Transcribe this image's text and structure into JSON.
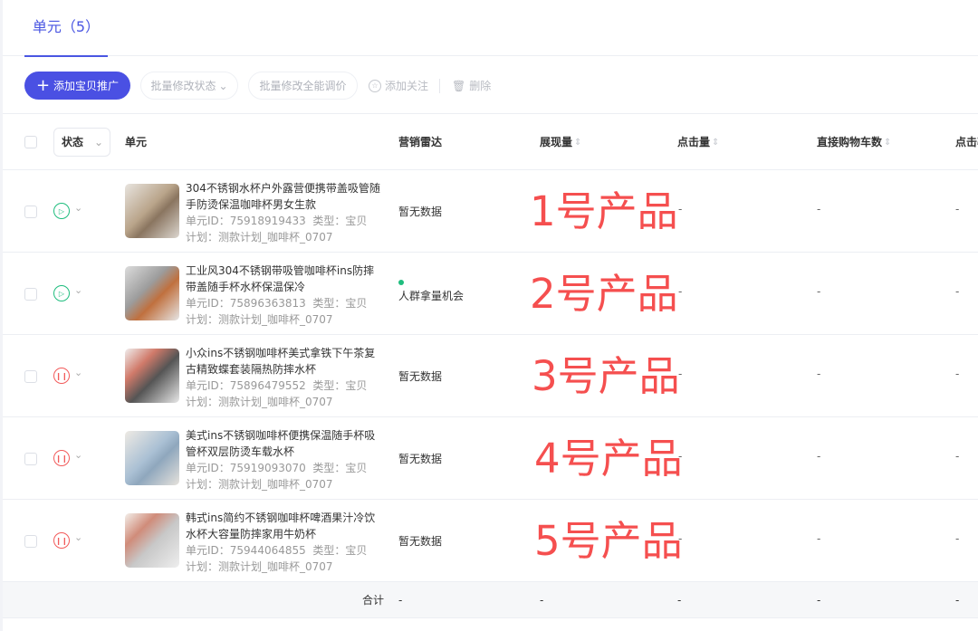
{
  "tab": {
    "label": "单元（5）"
  },
  "toolbar": {
    "add": "添加宝贝推广",
    "batch_status": "批量修改状态",
    "batch_price": "批量修改全能调价",
    "follow": "添加关注",
    "delete": "删除"
  },
  "columns": {
    "status": "状态",
    "unit": "单元",
    "radar": "营销雷达",
    "impressions": "展现量",
    "clicks": "点击量",
    "cart": "直接购物车数",
    "ctr": "点击率"
  },
  "colors": {
    "accent": "#4a50e3",
    "running": "#1fbd7e",
    "paused": "#f25b5b",
    "annotation": "#f54f4f"
  },
  "rows": [
    {
      "status": "running",
      "title": "304不锈钢水杯户外露营便携带盖吸管随手防烫保温咖啡杯男女生款",
      "id": "单元ID：75918919433",
      "type": "类型：宝贝",
      "plan": "计划：测款计划_咖啡杯_0707",
      "radar": "暂无数据",
      "impressions": "-",
      "clicks": "-",
      "cart": "-",
      "ctr": "-",
      "annotation": "1号产品"
    },
    {
      "status": "running",
      "title": "工业风304不锈钢带吸管咖啡杯ins防摔带盖随手杯水杯保温保冷",
      "id": "单元ID：75896363813",
      "type": "类型：宝贝",
      "plan": "计划：测款计划_咖啡杯_0707",
      "radar": "人群拿量机会",
      "impressions": "-",
      "clicks": "-",
      "cart": "-",
      "ctr": "-",
      "annotation": "2号产品"
    },
    {
      "status": "paused",
      "title": "小众ins不锈钢咖啡杯美式拿铁下午茶复古精致蝶套装隔热防摔水杯",
      "id": "单元ID：75896479552",
      "type": "类型：宝贝",
      "plan": "计划：测款计划_咖啡杯_0707",
      "radar": "暂无数据",
      "impressions": "-",
      "clicks": "-",
      "cart": "-",
      "ctr": "-",
      "annotation": "3号产品"
    },
    {
      "status": "paused",
      "title": "美式ins不锈钢咖啡杯便携保温随手杯吸管杯双层防烫车载水杯",
      "id": "单元ID：75919093070",
      "type": "类型：宝贝",
      "plan": "计划：测款计划_咖啡杯_0707",
      "radar": "暂无数据",
      "impressions": "-",
      "clicks": "-",
      "cart": "-",
      "ctr": "-",
      "annotation": "4号产品"
    },
    {
      "status": "paused",
      "title": "韩式ins简约不锈钢咖啡杯啤酒果汁冷饮水杯大容量防摔家用牛奶杯",
      "id": "单元ID：75944064855",
      "type": "类型：宝贝",
      "plan": "计划：测款计划_咖啡杯_0707",
      "radar": "暂无数据",
      "impressions": "-",
      "clicks": "-",
      "cart": "-",
      "ctr": "-",
      "annotation": "5号产品"
    }
  ],
  "total": {
    "label": "合计",
    "radar": "-",
    "impressions": "-",
    "clicks": "-",
    "cart": "-",
    "ctr": "-"
  }
}
